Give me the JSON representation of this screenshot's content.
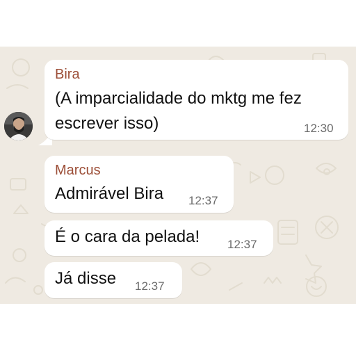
{
  "chat": {
    "messages": [
      {
        "sender": "Bira",
        "lines": [
          "(A imparcialidade do mktg me fez",
          "escrever isso)"
        ],
        "time": "12:30"
      },
      {
        "sender": "Marcus",
        "lines": [
          "Admirável Bira"
        ],
        "time": "12:37"
      },
      {
        "sender": "",
        "lines": [
          "É o cara da pelada!"
        ],
        "time": "12:37"
      },
      {
        "sender": "",
        "lines": [
          "Já disse"
        ],
        "time": "12:37"
      }
    ]
  },
  "colors": {
    "wallpaper": "#efeae2",
    "bubble": "#ffffff",
    "sender_name": "#9c4e37",
    "timestamp": "#6b6b6b"
  },
  "icons": [
    "avatar"
  ]
}
